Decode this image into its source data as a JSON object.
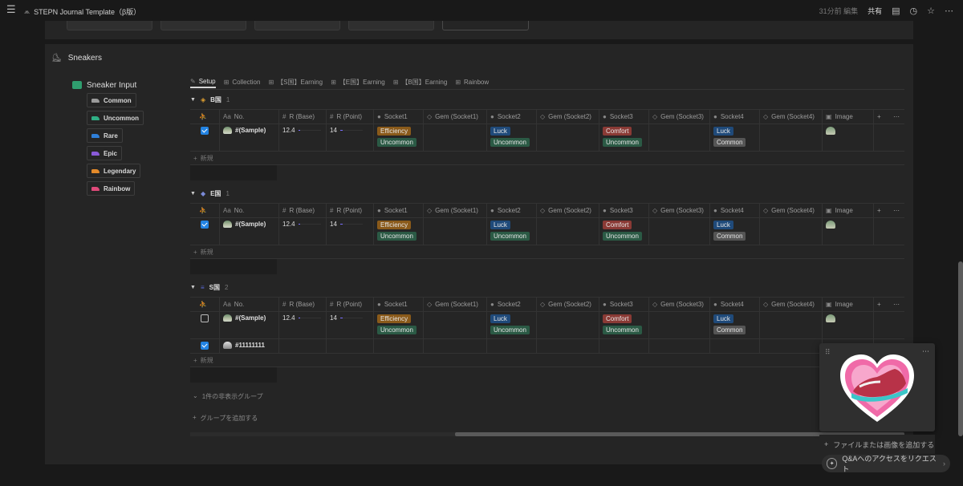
{
  "topbar": {
    "title": "STEPN Journal Template（β版）",
    "edited": "31分前 編集",
    "share": "共有",
    "icons": [
      "menu-icon",
      "page-icon",
      "comment-icon",
      "clock-icon",
      "star-icon",
      "more-icon"
    ]
  },
  "section": {
    "title": "Sneakers",
    "icon": "sneaker-icon"
  },
  "sidebar": {
    "heading": "Sneaker Input",
    "items": [
      {
        "label": "Common",
        "color": "#9b9b9b"
      },
      {
        "label": "Uncommon",
        "color": "#2fae84"
      },
      {
        "label": "Rare",
        "color": "#2f7fd8"
      },
      {
        "label": "Epic",
        "color": "#8a5ad8"
      },
      {
        "label": "Legendary",
        "color": "#e38a2a"
      },
      {
        "label": "Rainbow",
        "color": "#e04a7a"
      }
    ]
  },
  "tabs": [
    {
      "label": "Setup",
      "icon": "wrench-icon",
      "active": true
    },
    {
      "label": "Collection",
      "icon": "gallery-icon"
    },
    {
      "label": "【S国】Earning",
      "icon": "table-icon"
    },
    {
      "label": "【E国】Earning",
      "icon": "table-icon"
    },
    {
      "label": "【B国】Earning",
      "icon": "table-icon"
    },
    {
      "label": "Rainbow",
      "icon": "gallery-icon"
    }
  ],
  "columns": [
    {
      "label": "",
      "icon": "run-icon"
    },
    {
      "label": "No.",
      "icon": "Aa"
    },
    {
      "label": "R (Base)",
      "icon": "#"
    },
    {
      "label": "R (Point)",
      "icon": "#"
    },
    {
      "label": "Socket1",
      "icon": "●"
    },
    {
      "label": "Gem (Socket1)",
      "icon": "◇"
    },
    {
      "label": "Socket2",
      "icon": "●"
    },
    {
      "label": "Gem (Socket2)",
      "icon": "◇"
    },
    {
      "label": "Socket3",
      "icon": "●"
    },
    {
      "label": "Gem (Socket3)",
      "icon": "◇"
    },
    {
      "label": "Socket4",
      "icon": "●"
    },
    {
      "label": "Gem (Socket4)",
      "icon": "◇"
    },
    {
      "label": "Image",
      "icon": "▣"
    }
  ],
  "groups": [
    {
      "name": "B国",
      "count": "1",
      "icon": "◈",
      "icon_color": "#e0a030",
      "rows": [
        {
          "checked": true,
          "name": "#(Sample)",
          "base": "12.4",
          "base_fill": 0.1,
          "point": "14",
          "point_fill": 0.1,
          "s1": [
            "Efficiency",
            "Uncommon"
          ],
          "s2": [
            "Luck",
            "Uncommon"
          ],
          "s3": [
            "Comfort",
            "Uncommon"
          ],
          "s4": [
            "Luck",
            "Common"
          ],
          "has_image": true
        }
      ]
    },
    {
      "name": "E国",
      "count": "1",
      "icon": "◆",
      "icon_color": "#7a8ad8",
      "rows": [
        {
          "checked": true,
          "name": "#(Sample)",
          "base": "12.4",
          "base_fill": 0.1,
          "point": "14",
          "point_fill": 0.1,
          "s1": [
            "Efficiency",
            "Uncommon"
          ],
          "s2": [
            "Luck",
            "Uncommon"
          ],
          "s3": [
            "Comfort",
            "Uncommon"
          ],
          "s4": [
            "Luck",
            "Common"
          ],
          "has_image": true
        }
      ]
    },
    {
      "name": "S国",
      "count": "2",
      "icon": "≡",
      "icon_color": "#5a6ad8",
      "rows": [
        {
          "checked": false,
          "name": "#(Sample)",
          "base": "12.4",
          "base_fill": 0.1,
          "point": "14",
          "point_fill": 0.1,
          "s1": [
            "Efficiency",
            "Uncommon"
          ],
          "s2": [
            "Luck",
            "Uncommon"
          ],
          "s3": [
            "Comfort",
            "Uncommon"
          ],
          "s4": [
            "Luck",
            "Common"
          ],
          "has_image": true
        },
        {
          "checked": true,
          "name": "#11111111",
          "base": "",
          "point": "",
          "s1": [],
          "s2": [],
          "s3": [],
          "s4": [],
          "has_image": false
        }
      ]
    }
  ],
  "new_row_label": "新規",
  "hidden_groups": "1件の非表示グループ",
  "add_group": "グループを追加する",
  "popup": {
    "add_file": "ファイルまたは画像を追加する"
  },
  "qa": {
    "label": "Q&Aへのアクセスをリクエスト"
  },
  "tag_colors": {
    "Efficiency": "t-orange",
    "Uncommon": "t-green",
    "Luck": "t-blue",
    "Comfort": "t-red",
    "Common": "t-grey"
  }
}
